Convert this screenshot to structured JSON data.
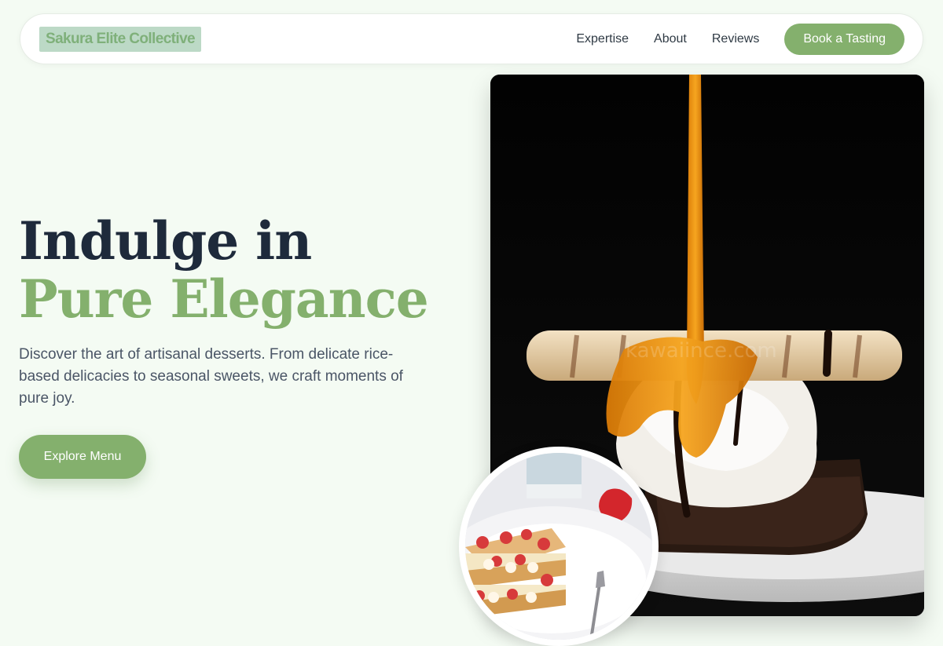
{
  "brand": {
    "name": "Sakura Elite Collective"
  },
  "nav": {
    "links": [
      "Expertise",
      "About",
      "Reviews"
    ],
    "cta": "Book a Tasting"
  },
  "hero": {
    "title_part1": "Indulge in ",
    "title_accent": "Pure Elegance",
    "subtitle": "Discover the art of artisanal desserts. From delicate rice-based delicacies to seasonal sweets, we craft moments of pure joy.",
    "cta": "Explore Menu"
  },
  "images": {
    "main": {
      "watermark": "kawaiince.com"
    }
  },
  "colors": {
    "accent": "#84b06d",
    "heading": "#1e2a3b",
    "background": "#f4fbf3"
  }
}
